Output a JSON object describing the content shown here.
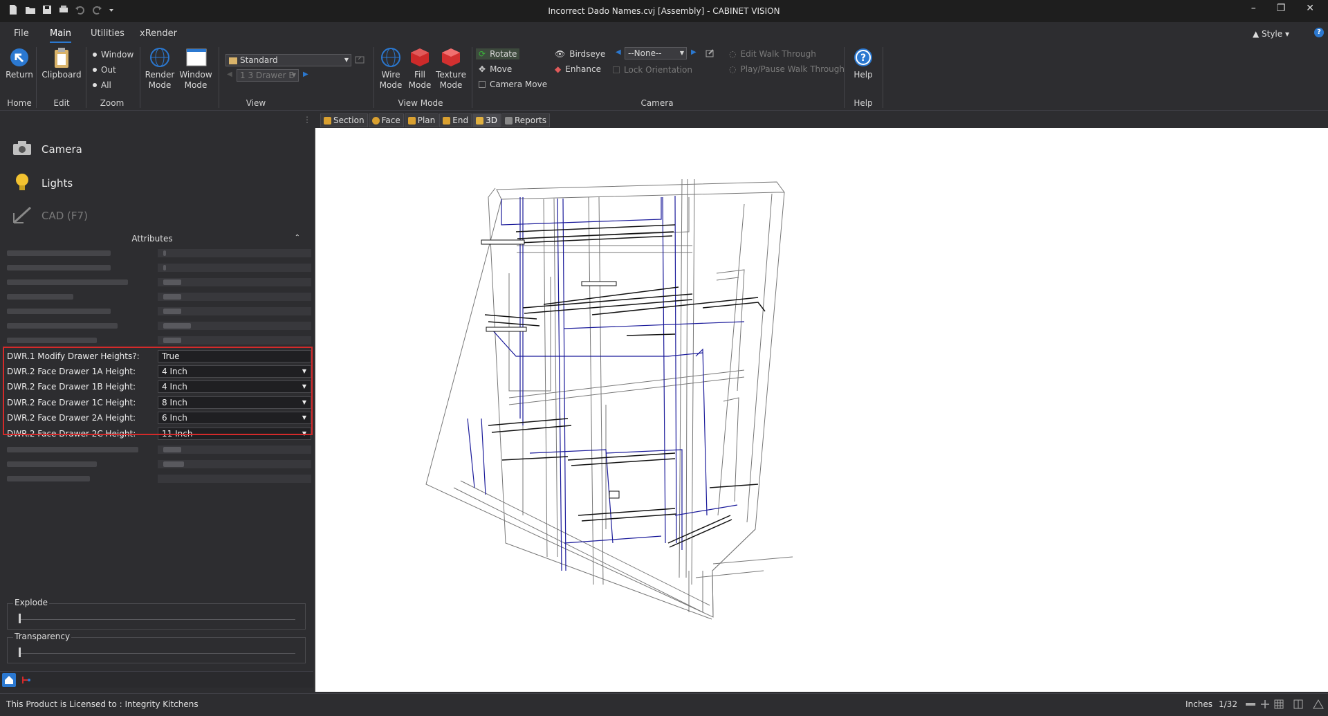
{
  "window": {
    "title": "Incorrect Dado Names.cvj [Assembly] - CABINET VISION",
    "minimize": "–",
    "restore": "❐",
    "close": "✕"
  },
  "ribbon_tabs": [
    "File",
    "Main",
    "Utilities",
    "xRender"
  ],
  "style_label": "▲ Style ▾",
  "help_glyph": "?",
  "ribbon": {
    "home": {
      "return_label": "Return",
      "group": "Home"
    },
    "edit": {
      "clipboard_label": "Clipboard",
      "group": "Edit"
    },
    "zoom": {
      "window": "Window",
      "out": "Out",
      "all": "All",
      "group": "Zoom"
    },
    "render_mode": "Render Mode",
    "window_mode": "Window Mode",
    "view": {
      "style_value": "Standard",
      "drawer_value": "1 3 Drawer E",
      "group": "View"
    },
    "view_mode": {
      "wire": "Wire Mode",
      "fill": "Fill Mode",
      "texture": "Texture Mode",
      "group": "View Mode"
    },
    "camera": {
      "rotate": "Rotate",
      "move": "Move",
      "camera_move": "Camera Move",
      "birdseye": "Birdseye",
      "enhance": "Enhance",
      "preset_value": "--None--",
      "lock_orientation": "Lock Orientation",
      "edit_walk": "Edit Walk Through",
      "play_walk": "Play/Pause Walk Through",
      "group": "Camera"
    },
    "help": {
      "label": "Help",
      "group": "Help"
    }
  },
  "view_tabs": [
    "Section",
    "Face",
    "Plan",
    "End",
    "3D",
    "Reports"
  ],
  "left_panel": {
    "camera": "Camera",
    "lights": "Lights",
    "cad": "CAD (F7)",
    "attributes_title": "Attributes",
    "attributes": [
      {
        "name": "DWR.1 Modify Drawer Heights?:",
        "value": "True",
        "dropdown": false
      },
      {
        "name": "DWR.2 Face Drawer 1A Height:",
        "value": "4 Inch",
        "dropdown": true
      },
      {
        "name": "DWR.2 Face Drawer 1B Height:",
        "value": "4 Inch",
        "dropdown": true
      },
      {
        "name": "DWR.2 Face Drawer 1C Height:",
        "value": "8 Inch",
        "dropdown": true
      },
      {
        "name": "DWR.2 Face Drawer 2A Height:",
        "value": "6 Inch",
        "dropdown": true
      },
      {
        "name": "DWR.2 Face Drawer 2C Height:",
        "value": "11 Inch",
        "dropdown": true
      }
    ],
    "explode_label": "Explode",
    "explode_value": 0,
    "transparency_label": "Transparency",
    "transparency_value": 0
  },
  "status": {
    "license": "This Product is Licensed to : Integrity Kitchens",
    "units": "Inches",
    "precision": "1/32"
  },
  "colors": {
    "accent": "#2b78d0",
    "highlight": "#d42a2a",
    "viewport_bg": "#ffffff",
    "wire_blue": "#1a1a9a"
  }
}
